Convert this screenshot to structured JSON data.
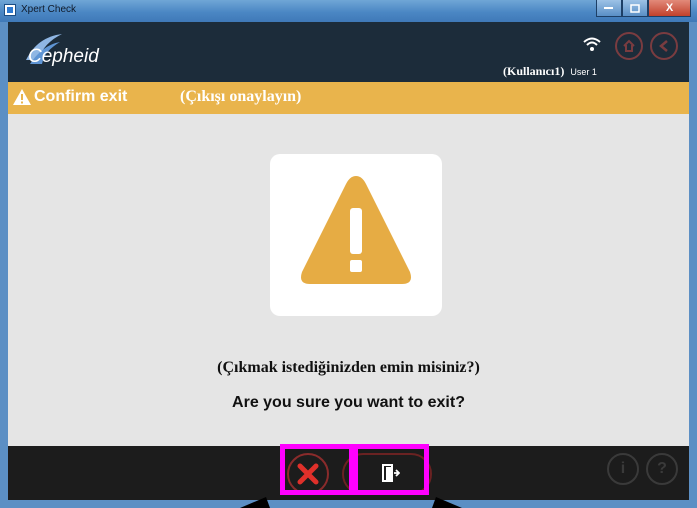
{
  "window": {
    "title": "Xpert Check",
    "close_glyph": "X"
  },
  "header": {
    "logo_text": "Cepheid",
    "user_tr": "(Kullanıcı1)",
    "user_en": "User 1",
    "icons": [
      "wifi-icon",
      "home-icon",
      "back-icon"
    ]
  },
  "banner": {
    "title_en": "Confirm exit",
    "title_tr": "(Çıkışı onaylayın)",
    "warning_icon": "warning-icon"
  },
  "dialog": {
    "question_tr": "(Çıkmak istediğinizden emin misiniz?)",
    "question_en": "Are you sure you want to exit?"
  },
  "footer": {
    "cancel_icon": "cancel-x-icon",
    "exit_icon": "exit-door-icon",
    "info_label": "i",
    "help_label": "?"
  },
  "colors": {
    "header_bg": "#1c2c3a",
    "banner": "#e9b44c",
    "content_bg": "#e5e5e5",
    "highlight": "#ff00ff",
    "cancel_red": "#e0302a"
  }
}
